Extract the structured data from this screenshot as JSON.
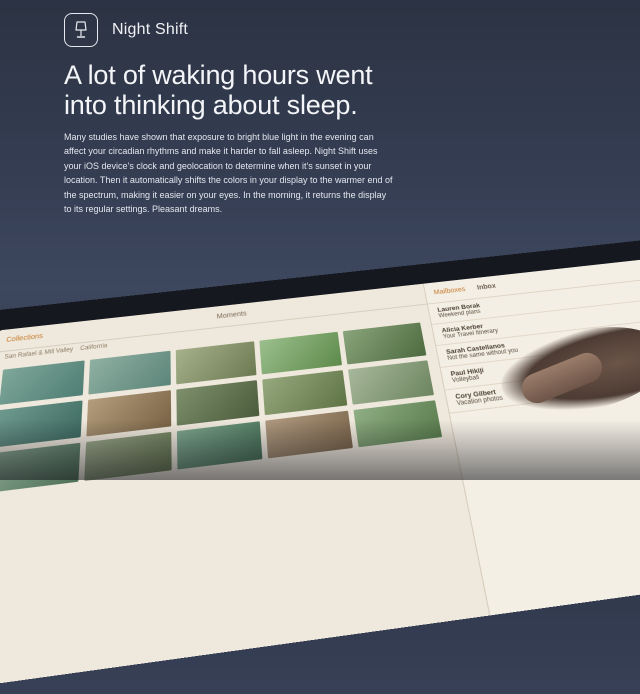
{
  "feature": {
    "icon": "lamp-icon",
    "title": "Night Shift"
  },
  "headline": {
    "line1": "A lot of waking hours went",
    "line2": "into thinking about sleep."
  },
  "body": "Many studies have shown that exposure to bright blue light in the evening can affect your circadian rhythms and make it harder to fall asleep. Night Shift uses your iOS device’s clock and geolocation to determine when it’s sunset in your location. Then it automatically shifts the colors in your display to the warmer end of the spectrum, making it easier on your eyes. In the morning, it returns the display to its regular settings. Pleasant dreams.",
  "device": {
    "photos": {
      "back_label": "Collections",
      "title": "Moments",
      "subtitle_left": "San Rafael & Mill Valley",
      "subtitle_right": "California"
    },
    "mail": {
      "back_label": "Mailboxes",
      "title": "Inbox",
      "items": [
        {
          "from": "Lauren Borak",
          "time": "",
          "subject": "Weekend plans",
          "preview": ""
        },
        {
          "from": "Alicia Kerber",
          "time": "",
          "subject": "Your Travel Itinerary",
          "preview": ""
        },
        {
          "from": "Sarah Castellanos",
          "time": "",
          "subject": "Not the same without you",
          "preview": ""
        },
        {
          "from": "Paul Hikiji",
          "time": "",
          "subject": "Volleyball",
          "preview": ""
        },
        {
          "from": "Cory Gilbert",
          "time": "",
          "subject": "Vacation photos",
          "preview": ""
        }
      ]
    }
  },
  "colors": {
    "background_top": "#2c3343",
    "background_bottom": "#262b36",
    "warm_screen": "#eae3d6",
    "accent_orange": "#c47a2b"
  }
}
